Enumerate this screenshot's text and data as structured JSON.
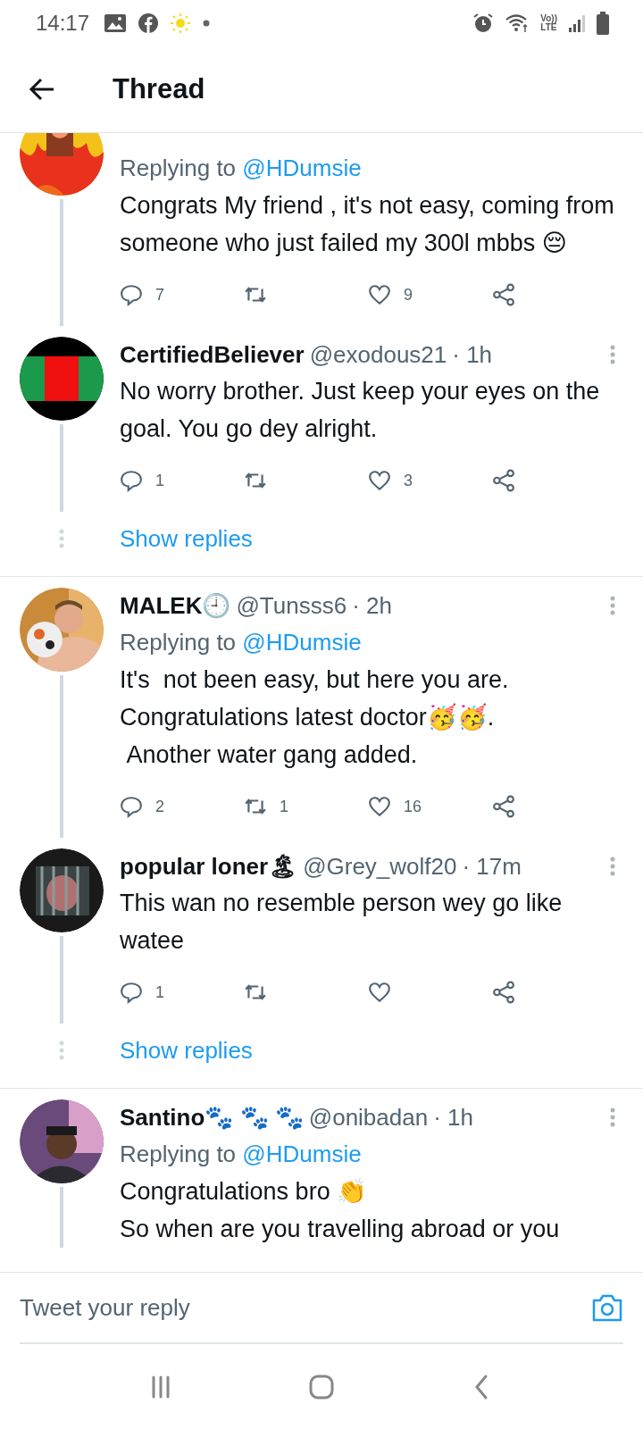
{
  "status_bar": {
    "time": "14:17",
    "network_label": [
      "Vo))",
      "LTE"
    ]
  },
  "header": {
    "title": "Thread"
  },
  "tweets": [
    {
      "replying_to": "Replying to",
      "replying_handle": "@HDumsie",
      "text": "Congrats My friend , it's not easy, coming from someone who just failed my 300l mbbs 😔",
      "actions": {
        "replies": "7",
        "likes": "9"
      }
    },
    {
      "name": "CertifiedBeliever",
      "handle": "@exodous21",
      "time": "· 1h",
      "text": "No worry brother. Just keep your eyes on the goal. You go dey alright.",
      "actions": {
        "replies": "1",
        "likes": "3"
      },
      "show_replies_label": "Show replies"
    },
    {
      "name": "MALEK🕘",
      "handle": "@Tunsss6",
      "time": "· 2h",
      "replying_to": "Replying to",
      "replying_handle": "@HDumsie",
      "text": "It's  not been easy, but here you are.\nCongratulations latest doctor🥳🥳.\n Another water gang added.",
      "actions": {
        "replies": "2",
        "retweets": "1",
        "likes": "16"
      }
    },
    {
      "name": "popular loner🏝",
      "handle": "@Grey_wolf20",
      "time": "· 17m",
      "text": "This wan no resemble person wey go like watee",
      "actions": {
        "replies": "1"
      },
      "show_replies_label": "Show replies"
    },
    {
      "name": "Santino🐾 🐾 🐾",
      "handle": "@onibadan",
      "time": "· 1h",
      "replying_to": "Replying to",
      "replying_handle": "@HDumsie",
      "text": "Congratulations bro 👏\nSo when are you travelling abroad or you"
    }
  ],
  "composer": {
    "placeholder": "Tweet your reply"
  }
}
